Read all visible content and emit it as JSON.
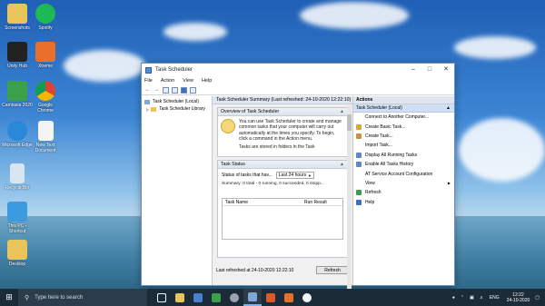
{
  "desktop": {
    "icons": [
      {
        "label": "Screenshots"
      },
      {
        "label": "Spotify"
      },
      {
        "label": "Unity Hub"
      },
      {
        "label": "Xtreme"
      },
      {
        "label": "Camtasia 2020"
      },
      {
        "label": "Google Chrome"
      },
      {
        "label": "Microsoft Edge"
      },
      {
        "label": "New Text Document"
      },
      {
        "label": "Recycle Bin"
      },
      {
        "label": "This PC - Shortcut"
      },
      {
        "label": "Desktop"
      }
    ]
  },
  "window": {
    "title": "Task Scheduler",
    "menu": [
      "File",
      "Action",
      "View",
      "Help"
    ],
    "tree": {
      "root": "Task Scheduler (Local)",
      "child": "Task Scheduler Library"
    },
    "summary_header": "Task Scheduler Summary (Last refreshed: 24-10-2020 12:22:10)",
    "overview": {
      "header": "Overview of Task Scheduler",
      "text": "You can use Task Scheduler to create and manage common tasks that your computer will carry out automatically at the times you specify. To begin, click a command in the Action menu.",
      "text2": "Tasks are stored in folders in the Task"
    },
    "task_status": {
      "header": "Task Status",
      "status_label": "Status of tasks that hav...",
      "period": "Last 24 hours",
      "summary": "Summary: 0 total - 0 running, 0 succeeded, 0 stopp...",
      "columns": [
        "Task Name",
        "Run Result"
      ]
    },
    "footer": {
      "last_refreshed": "Last refreshed at 24-10-2020 12:22:10",
      "refresh_button": "Refresh"
    },
    "actions": {
      "header": "Actions",
      "selected": "Task Scheduler (Local)",
      "items": [
        {
          "label": "Connect to Another Computer...",
          "icon": "connect-icon",
          "color": "#ffffff"
        },
        {
          "label": "Create Basic Task...",
          "icon": "create-basic-task-icon",
          "color": "#d9a63a"
        },
        {
          "label": "Create Task...",
          "icon": "create-task-icon",
          "color": "#c98f3a"
        },
        {
          "label": "Import Task...",
          "icon": "import-task-icon",
          "color": "#ffffff"
        },
        {
          "label": "Display All Running Tasks",
          "icon": "running-tasks-icon",
          "color": "#5b87c4"
        },
        {
          "label": "Enable All Tasks History",
          "icon": "history-icon",
          "color": "#5b87c4"
        },
        {
          "label": "AT Service Account Configuration",
          "icon": "at-service-icon",
          "color": "#ffffff"
        },
        {
          "label": "View",
          "icon": "view-icon",
          "color": "#ffffff",
          "submenu": "▶"
        },
        {
          "label": "Refresh",
          "icon": "refresh-icon",
          "color": "#3aa14a"
        },
        {
          "label": "Help",
          "icon": "help-icon",
          "color": "#3c6fc4"
        }
      ]
    }
  },
  "taskbar": {
    "search_placeholder": "Type here to search",
    "language": "ENG",
    "time": "12:22",
    "date": "24-10-2020"
  }
}
